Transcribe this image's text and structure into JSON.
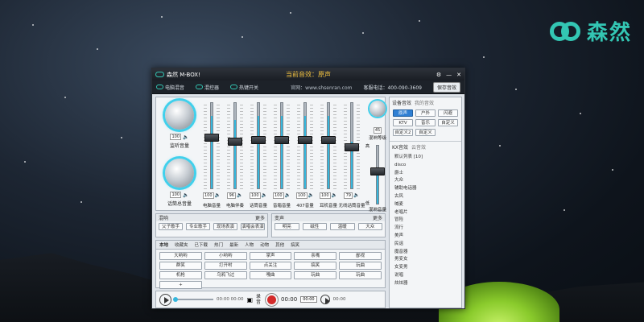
{
  "brand": {
    "logo_text": "森然"
  },
  "window": {
    "app_name": "森然 M-BOX!",
    "current_effect": "当前音效：原声"
  },
  "topbar": {
    "items": [
      "电脑混音",
      "混控器",
      "热键开关"
    ],
    "site": "官网：www.shsenran.com",
    "hotline": "客服电话：400-090-3609",
    "save_label": "保存音效"
  },
  "mixer": {
    "knobs": [
      {
        "value": "100",
        "label": "监听音量"
      },
      {
        "value": "100",
        "label": "话筒总音量"
      }
    ],
    "channels": [
      {
        "value": "100",
        "label": "电脑音量",
        "level": 0.85,
        "thumb": 0.4
      },
      {
        "value": "96",
        "label": "电脑伴奏",
        "level": 0.8,
        "thumb": 0.45
      },
      {
        "value": "100",
        "label": "话筒音量",
        "level": 0.85,
        "thumb": 0.43
      },
      {
        "value": "100",
        "label": "音箱音量",
        "level": 0.85,
        "thumb": 0.43
      },
      {
        "value": "100",
        "label": "407音量",
        "level": 0.85,
        "thumb": 0.43
      },
      {
        "value": "100",
        "label": "耳机音量",
        "level": 0.85,
        "thumb": 0.43
      },
      {
        "value": "79",
        "label": "无线话筒音量",
        "level": 0.55,
        "thumb": 0.52
      }
    ],
    "reverb": {
      "value": "45",
      "label": "混响等级",
      "hi": "高",
      "lo": "低",
      "bottom_label": "混响音量"
    }
  },
  "presets": {
    "title": "混响",
    "more": "更多",
    "buttons": [
      "父子歌手",
      "专业歌手",
      "现场表演",
      "演唱会表演"
    ]
  },
  "voice_change": {
    "title": "变声",
    "more": "更多",
    "buttons": [
      "明亮",
      "磁性",
      "温暖",
      "大众"
    ]
  },
  "effects": {
    "tabs": [
      "本地",
      "收藏夹",
      "已下载",
      "热门",
      "最新",
      "人物",
      "动物",
      "其他",
      "搞笑"
    ],
    "buttons": [
      "大哟哟",
      "小哟哟",
      "掌声",
      "亲嘴",
      "鄙视",
      "群笑",
      "打开咐",
      "点关注",
      "搞笑",
      "玩曲",
      "机枪",
      "乌鸦飞过",
      "嘎曲",
      "玩曲",
      "玩曲",
      "+"
    ]
  },
  "player": {
    "time": "00:00 00:00",
    "rec_label": "录音",
    "rec_time": "00:00",
    "rec_box": "00:00",
    "rec_end": "00:00"
  },
  "environment": {
    "title": "设备音效",
    "subtitle": "我的音效",
    "buttons": [
      "原声",
      "户外",
      "闪避",
      "KTV",
      "音乐",
      "自定义",
      "自定义2",
      "自定义"
    ],
    "selected": 0
  },
  "kx": {
    "title": "KX音效",
    "subtitle": "云音效",
    "items": [
      "默认列表 [10]",
      "disco",
      "爵士",
      "大众",
      "辅助电话器",
      "古风",
      "喊麦",
      "老唱片",
      "冒险",
      "流行",
      "美声",
      "民谣",
      "魔音器",
      "男变女",
      "女变男",
      "说唱",
      "炫炫器"
    ]
  }
}
